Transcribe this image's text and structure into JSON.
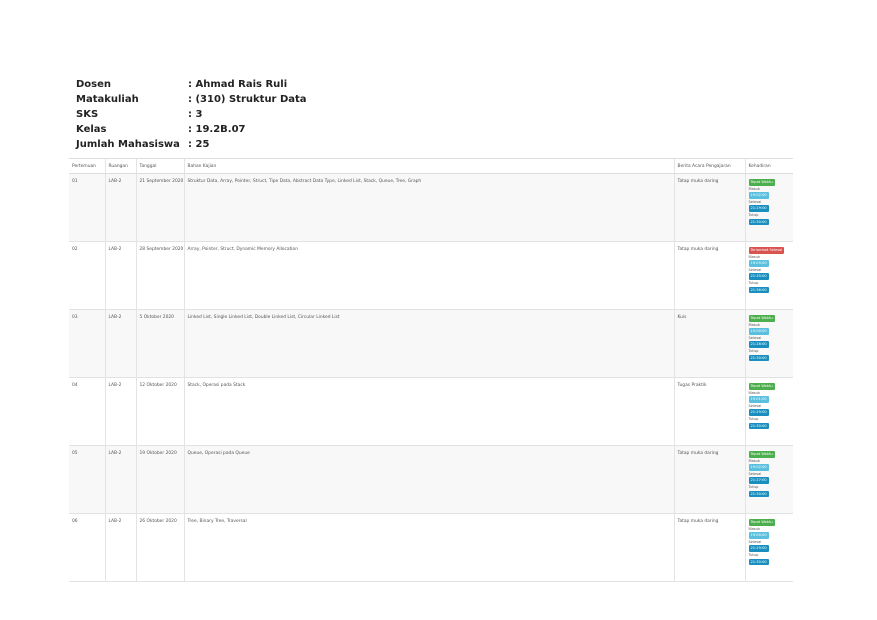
{
  "info": [
    {
      "label": "Dosen",
      "value": ": Ahmad Rais Ruli"
    },
    {
      "label": "Matakuliah",
      "value": ": (310) Struktur Data"
    },
    {
      "label": "SKS",
      "value": ": 3"
    },
    {
      "label": "Kelas",
      "value": ": 19.2B.07"
    },
    {
      "label": "Jumlah Mahasiswa",
      "value": ": 25"
    }
  ],
  "table": {
    "headers": [
      "Pertemuan",
      "Ruangan",
      "Tanggal",
      "Bahan Kajian",
      "Berita Acara Pengajaran",
      "Kehadiran"
    ],
    "rows": [
      {
        "pertemuan": "01",
        "ruangan": "LAB-2",
        "tanggal": "21 September 2020",
        "bahan": "Struktur Data, Array, Pointer, Struct, Tipe Data, Abstract Data Type, Linked List, Stack, Queue, Tree, Graph",
        "berita": "Tatap muka daring",
        "status": "Tepat Waktu",
        "k1": "Masuk",
        "t1": "19:02:00",
        "k2": "Selesai",
        "t2": "21:29:00",
        "k3": "Tutup",
        "t3": "21:30:00"
      },
      {
        "pertemuan": "02",
        "ruangan": "LAB-2",
        "tanggal": "28 September 2020",
        "bahan": "Array, Pointer, Struct, Dynamic Memory Allocation",
        "berita": "Tatap muka daring",
        "status": "Terlambat Selesai",
        "k1": "Masuk",
        "t1": "19:05:00",
        "k2": "Selesai",
        "t2": "21:35:00",
        "k3": "Tutup",
        "t3": "21:36:00"
      },
      {
        "pertemuan": "03",
        "ruangan": "LAB-2",
        "tanggal": "5 Oktober 2020",
        "bahan": "Linked List, Single Linked List, Double Linked List, Circular Linked List",
        "berita": "Kuis",
        "status": "Tepat Waktu",
        "k1": "Masuk",
        "t1": "19:00:00",
        "k2": "Selesai",
        "t2": "21:28:00",
        "k3": "Tutup",
        "t3": "21:30:00"
      },
      {
        "pertemuan": "04",
        "ruangan": "LAB-2",
        "tanggal": "12 Oktober 2020",
        "bahan": "Stack, Operasi pada Stack",
        "berita": "Tugas Praktik",
        "status": "Tepat Waktu",
        "k1": "Masuk",
        "t1": "19:01:00",
        "k2": "Selesai",
        "t2": "21:29:00",
        "k3": "Tutup",
        "t3": "21:30:00"
      },
      {
        "pertemuan": "05",
        "ruangan": "LAB-2",
        "tanggal": "19 Oktober 2020",
        "bahan": "Queue, Operasi pada Queue",
        "berita": "Tatap muka daring",
        "status": "Tepat Waktu",
        "k1": "Masuk",
        "t1": "19:02:00",
        "k2": "Selesai",
        "t2": "21:27:00",
        "k3": "Tutup",
        "t3": "21:30:00"
      },
      {
        "pertemuan": "06",
        "ruangan": "LAB-2",
        "tanggal": "26 Oktober 2020",
        "bahan": "Tree, Binary Tree, Traversal",
        "berita": "Tatap muka daring",
        "status": "Tepat Waktu",
        "k1": "Masuk",
        "t1": "19:00:00",
        "k2": "Selesai",
        "t2": "21:29:00",
        "k3": "Tutup",
        "t3": "21:30:00"
      }
    ]
  },
  "colors": {
    "ontime": "#4cae4c",
    "late": "#d9534f",
    "time": "#5bc0de",
    "time2": "#1a8fbf"
  }
}
